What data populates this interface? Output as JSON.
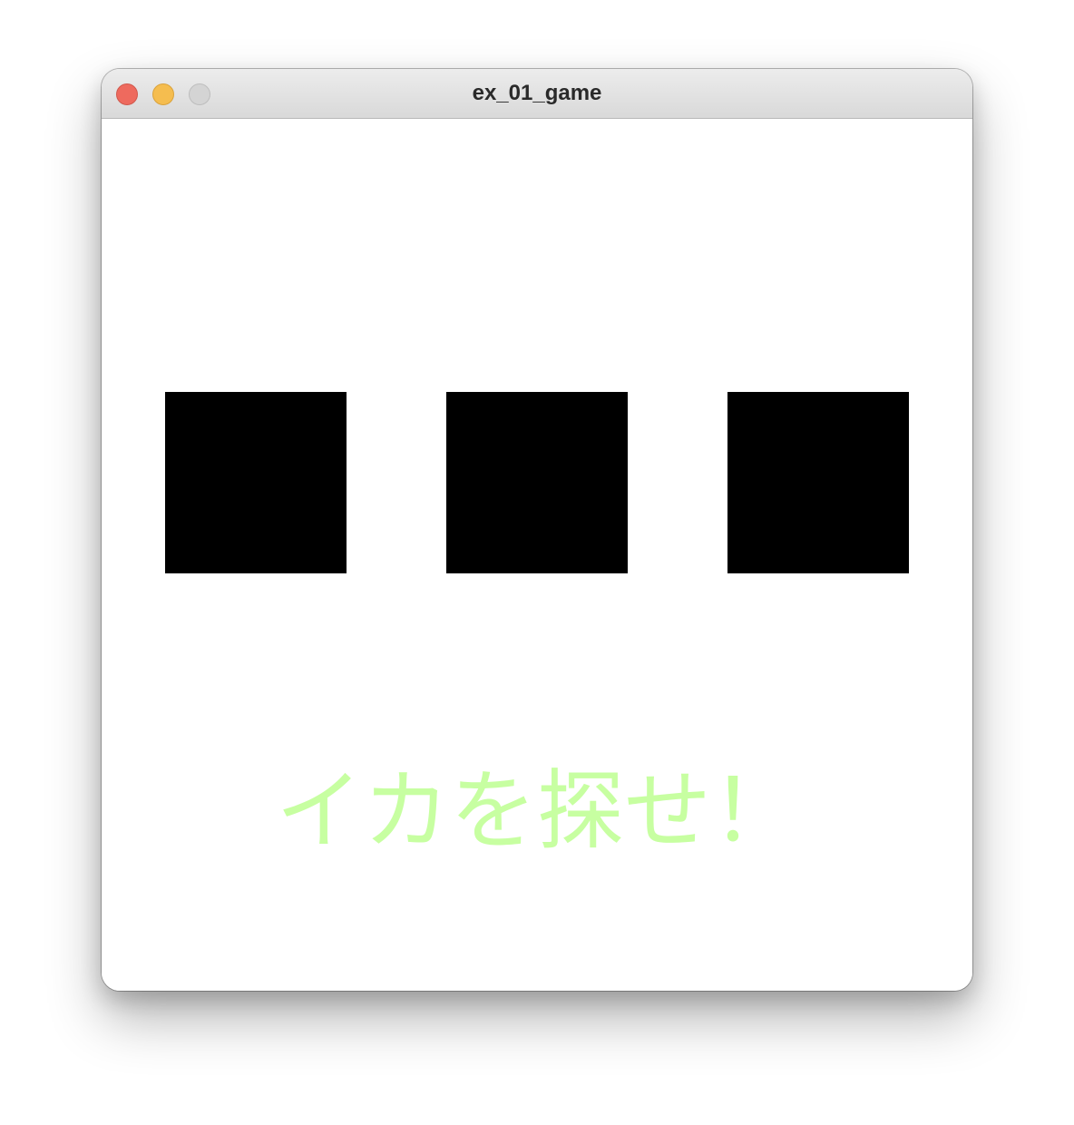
{
  "window": {
    "title": "ex_01_game"
  },
  "game": {
    "tiles": [
      {
        "id": 1,
        "state": "hidden",
        "color": "#000000"
      },
      {
        "id": 2,
        "state": "hidden",
        "color": "#000000"
      },
      {
        "id": 3,
        "state": "hidden",
        "color": "#000000"
      }
    ],
    "message": "イカを探せ！",
    "message_color": "#c7ffa1"
  }
}
